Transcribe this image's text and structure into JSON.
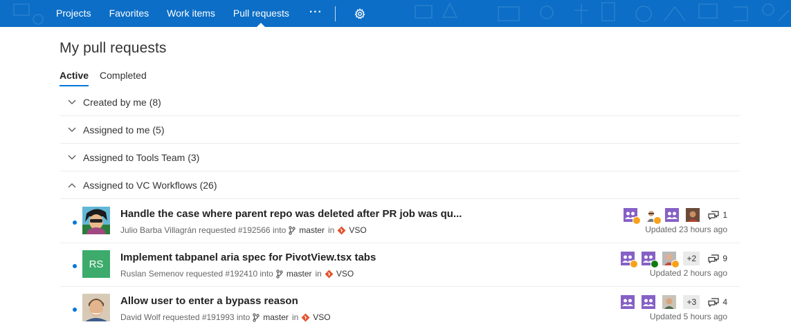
{
  "nav": {
    "items": [
      {
        "label": "Projects"
      },
      {
        "label": "Favorites"
      },
      {
        "label": "Work items"
      },
      {
        "label": "Pull requests"
      }
    ],
    "more_label": "···",
    "accent": "#0c6ec6"
  },
  "page": {
    "title": "My pull requests",
    "tabs": [
      {
        "label": "Active"
      },
      {
        "label": "Completed"
      }
    ]
  },
  "groups": [
    {
      "label": "Created by me (8)",
      "state": "collapsed"
    },
    {
      "label": "Assigned to me (5)",
      "state": "collapsed"
    },
    {
      "label": "Assigned to Tools Team (3)",
      "state": "collapsed"
    },
    {
      "label": "Assigned to VC Workflows (26)",
      "state": "expanded"
    }
  ],
  "pull_requests": [
    {
      "title": "Handle the case where parent repo was deleted after PR job was qu...",
      "author_line": "Julio Barba Villagrán requested #192566 into",
      "branch": "master",
      "in_label": "in",
      "repo": "VSO",
      "avatar_initials": "",
      "comments": "1",
      "more_reviewers": "",
      "updated": "Updated 23 hours ago"
    },
    {
      "title": "Implement tabpanel aria spec for PivotView.tsx tabs",
      "author_line": "Ruslan Semenov requested #192410 into",
      "branch": "master",
      "in_label": "in",
      "repo": "VSO",
      "avatar_initials": "RS",
      "comments": "9",
      "more_reviewers": "+2",
      "updated": "Updated 2 hours ago"
    },
    {
      "title": "Allow user to enter a bypass reason",
      "author_line": "David Wolf requested #191993 into",
      "branch": "master",
      "in_label": "in",
      "repo": "VSO",
      "avatar_initials": "",
      "comments": "4",
      "more_reviewers": "+3",
      "updated": "Updated 5 hours ago"
    }
  ],
  "colors": {
    "unread_dot": "#0078d7",
    "waiting_badge": "#f7a21b",
    "approved_badge": "#107c10",
    "team_avatar": "#8661c5",
    "repo_icon": "#e4532c",
    "initials_avatar": "#3dab6b"
  }
}
